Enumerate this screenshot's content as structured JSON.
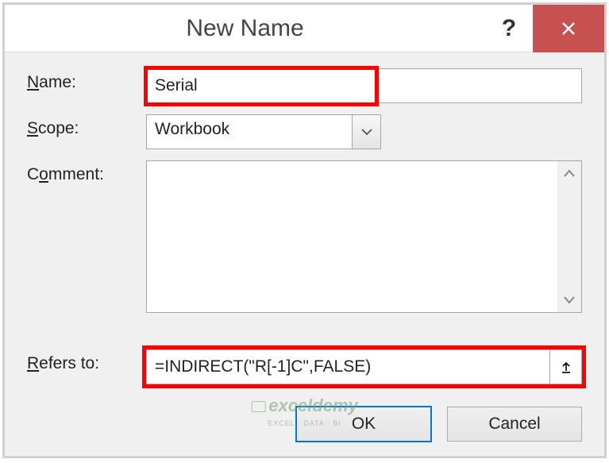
{
  "title": "New Name",
  "labels": {
    "name_prefix": "N",
    "name_rest": "ame:",
    "scope_prefix": "S",
    "scope_rest": "cope:",
    "comment_prefix": "o",
    "comment_pre": "C",
    "comment_rest": "mment:",
    "refers_prefix": "R",
    "refers_rest": "efers to:"
  },
  "fields": {
    "name_value": "Serial",
    "scope_value": "Workbook",
    "comment_value": "",
    "refers_value": "=INDIRECT(\"R[-1]C\",FALSE)"
  },
  "buttons": {
    "ok": "OK",
    "cancel": "Cancel",
    "help": "?"
  },
  "watermark": {
    "brand": "exceldemy",
    "tagline": "EXCEL · DATA · BI"
  }
}
